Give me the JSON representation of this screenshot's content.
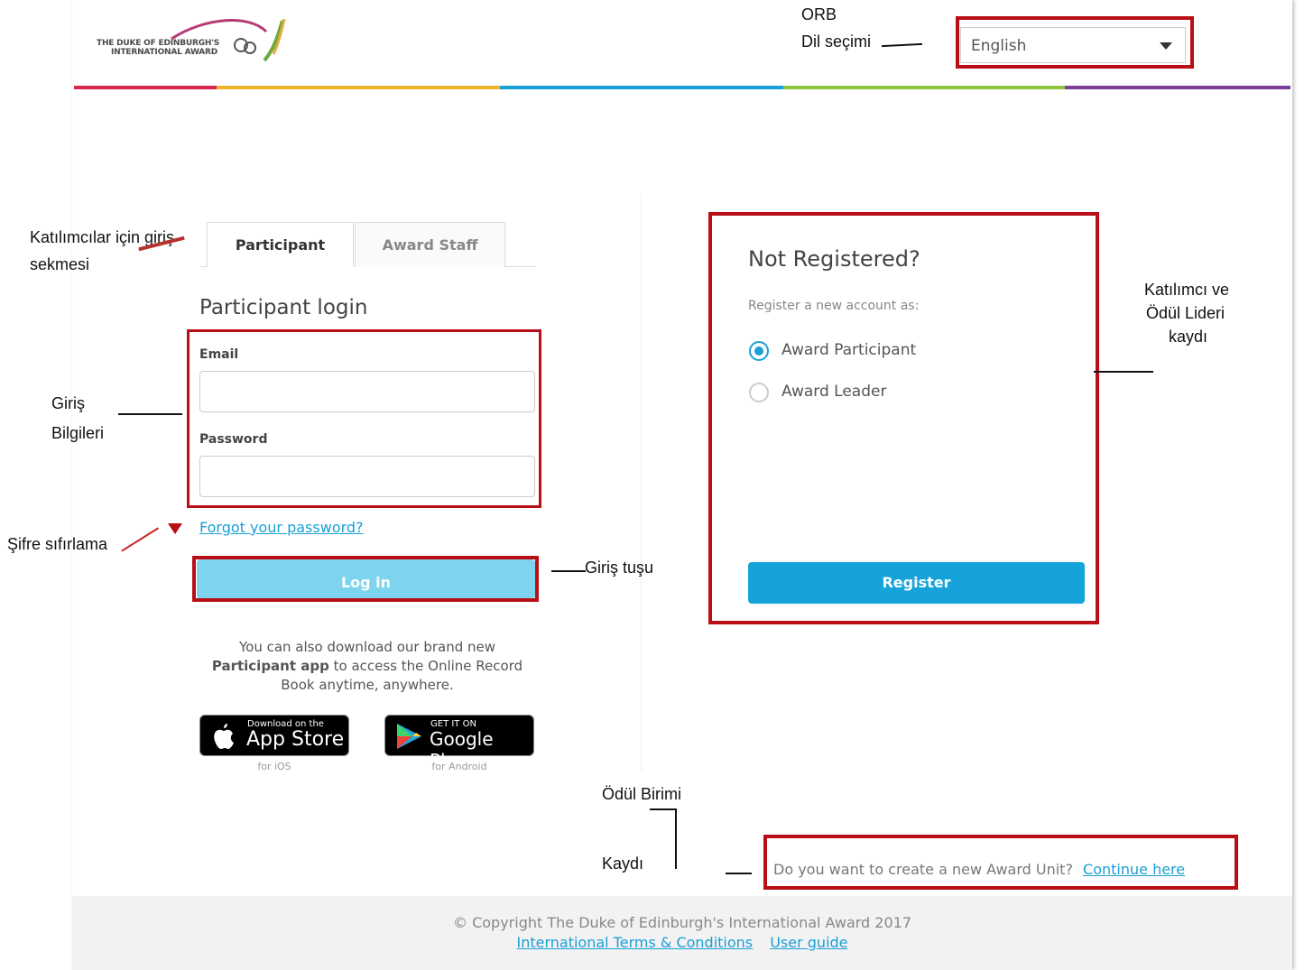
{
  "header": {
    "logo_line1": "THE DUKE OF EDINBURGH'S",
    "logo_line2": "INTERNATIONAL AWARD",
    "language_value": "English",
    "stripe_colors": [
      "#d8264f",
      "#f0b42b",
      "#1aa0d8",
      "#8cc63e",
      "#7b3f98"
    ]
  },
  "annotations": {
    "orb": "ORB",
    "lang_select": "Dil seçimi",
    "tab_note_line1": "Katılımcılar için giriş",
    "tab_note_line2": "sekmesi",
    "credentials_line1": "Giriş",
    "credentials_line2": "Bilgileri",
    "password_reset": "Şifre sıfırlama",
    "login_button_note": "Giriş tuşu",
    "register_note_line1": "Katılımcı ve",
    "register_note_line2": "Ödül Lideri",
    "register_note_line3": "kaydı",
    "award_unit_line1": "Ödül Birimi",
    "award_unit_line2": "Kaydı"
  },
  "login": {
    "tabs": [
      "Participant",
      "Award Staff"
    ],
    "title": "Participant login",
    "email_label": "Email",
    "email_value": "",
    "password_label": "Password",
    "password_value": "",
    "forgot_link": "Forgot your password?",
    "login_button": "Log in",
    "app_text_1": "You can also download our brand new",
    "app_text_bold": "Participant app",
    "app_text_2": " to access the Online Record",
    "app_text_3": "Book anytime, anywhere.",
    "appstore_small": "Download on the",
    "appstore_big": "App Store",
    "appstore_caption": "for iOS",
    "gplay_small": "GET IT ON",
    "gplay_big": "Google Play",
    "gplay_caption": "for Android"
  },
  "register": {
    "title": "Not Registered?",
    "subtitle": "Register a new account as:",
    "options": [
      "Award Participant",
      "Award Leader"
    ],
    "selected_option": "Award Participant",
    "button": "Register"
  },
  "award_unit": {
    "question": "Do you want to create a new Award Unit?",
    "link": "Continue here"
  },
  "footer": {
    "copyright": "© Copyright The Duke of Edinburgh's International Award 2017",
    "terms_link": "International Terms & Conditions",
    "guide_link": "User guide"
  },
  "colors": {
    "annotation_red": "#b80f16",
    "accent_blue": "#1aa0d8",
    "login_button": "#7ed3ee",
    "register_button": "#16a3da"
  }
}
